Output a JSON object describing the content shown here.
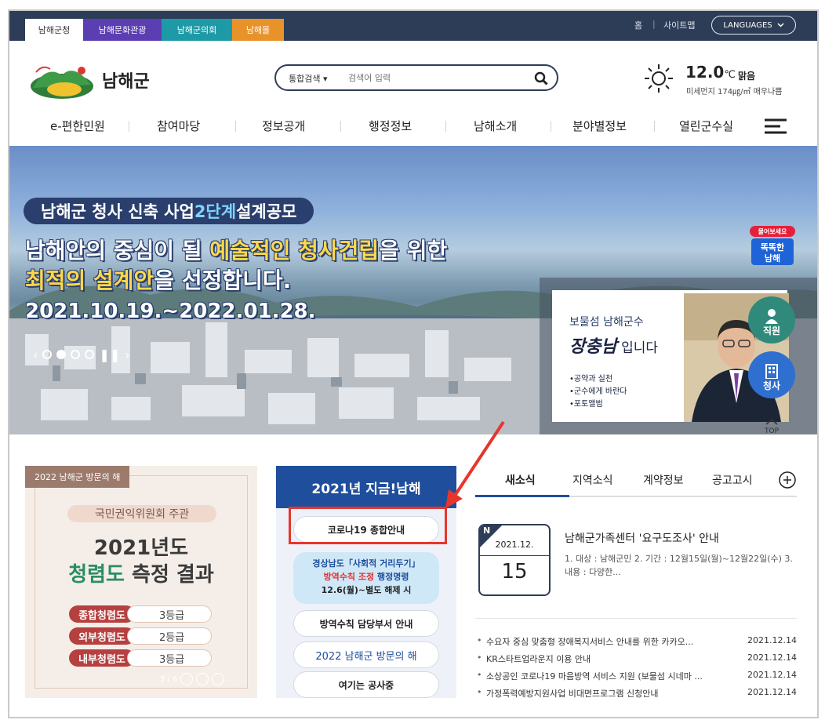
{
  "top_bar": {
    "site_tabs": [
      "남해군청",
      "남해문화관광",
      "남해군의회",
      "남해몰"
    ],
    "home": "홈",
    "separator": "|",
    "sitemap": "사이트맵",
    "languages": "LANGUAGES"
  },
  "header": {
    "logo_text": "남해군",
    "search": {
      "scope": "통합검색",
      "placeholder": "검색어 입력"
    },
    "weather": {
      "temperature": "12.0",
      "unit": "℃",
      "condition": "맑음",
      "dust": "미세먼지 174㎍/㎥ 매우나쁨"
    }
  },
  "gnb": [
    "e-편한민원",
    "참여마당",
    "정보공개",
    "행정정보",
    "남해소개",
    "분야별정보",
    "열린군수실"
  ],
  "hero": {
    "pill_prefix": "남해군 청사 신축 사업 ",
    "pill_highlight": "2단계",
    "pill_suffix": " 설계공모",
    "line1_a": "남해안의 중심이 될 ",
    "line1_b": "예술적인 청사건립",
    "line1_c": "을 위한",
    "line2_a": "최적의 설계안",
    "line2_b": "을 선정합니다.",
    "date": "2021.10.19.~2022.01.28.",
    "governor": {
      "subtitle": "보물섬 남해군수",
      "name": "장충남",
      "name_suffix": " 입니다",
      "links": [
        "•공약과 실천",
        "•군수에게 바란다",
        "•포토앨범"
      ]
    },
    "ask_label_top": "물어보세요",
    "ask_label_main": "똑똑한",
    "ask_label_sub": "남해",
    "staff": "직원",
    "office": "청사",
    "top": "TOP"
  },
  "banner": {
    "tag": "2022 남해군 방문의 해",
    "org": "국민권익위원회 주관",
    "year": "2021년도",
    "title_green": "청렴도",
    "title_rest": " 측정 결과",
    "grades": [
      {
        "name": "종합청렴도",
        "grade": "3등급"
      },
      {
        "name": "외부청렴도",
        "grade": "2등급"
      },
      {
        "name": "내부청렴도",
        "grade": "3등급"
      }
    ],
    "pager": "3 / 6"
  },
  "now_panel": {
    "title": "2021년 지금!남해",
    "covid": "코로나19 종합안내",
    "alert_line1": "경상남도「사회적 거리두기」",
    "alert_line2_red": "방역수칙 조정",
    "alert_line2_rest": " 행정명령",
    "alert_line3": "12.6(월)~별도 해제 시",
    "dept": "방역수칙 담당부서 안내",
    "visit": "2022 남해군 방문의 해",
    "construction": "여기는 공사중"
  },
  "news": {
    "tabs": [
      "새소식",
      "지역소식",
      "계약정보",
      "공고고시"
    ],
    "featured": {
      "badge": "N",
      "year_month": "2021.12.",
      "day": "15",
      "title": "남해군가족센터 '요구도조사' 안내",
      "desc": "1. 대상 : 남해군민 2. 기간 : 12월15일(월)~12월22일(수) 3. 내용 : 다양한..."
    },
    "items": [
      {
        "title": "수요자 중심 맞춤형 장애복지서비스 안내를 위한 카카오...",
        "date": "2021.12.14"
      },
      {
        "title": "KR스타트업라운지 이용 안내",
        "date": "2021.12.14"
      },
      {
        "title": "소상공인 코로나19 마음방역 서비스 지원 (보물섬 시네마 ...",
        "date": "2021.12.14"
      },
      {
        "title": "가정폭력예방지원사업 비대면프로그램 신청안내",
        "date": "2021.12.14"
      }
    ]
  },
  "colors": {
    "navy": "#2e3d57",
    "brand_blue": "#1f4e9c",
    "highlight_red": "#e8352c"
  }
}
